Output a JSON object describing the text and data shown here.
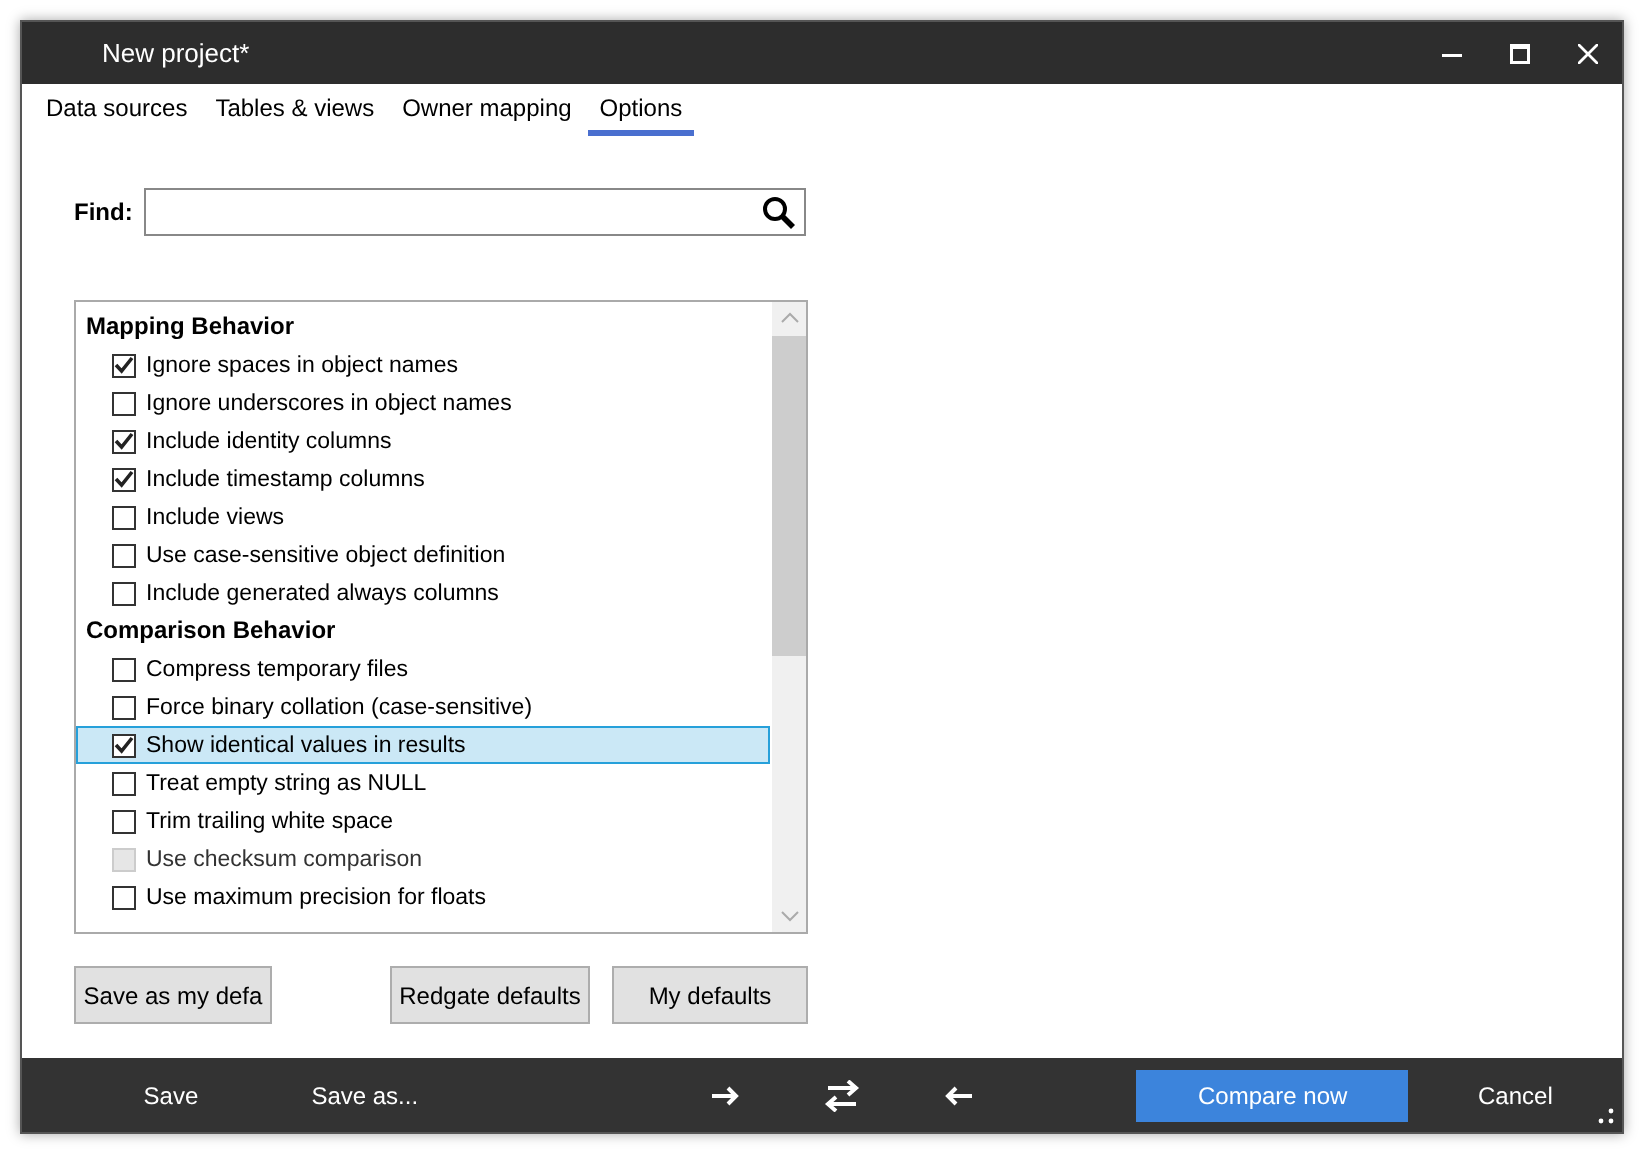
{
  "window": {
    "title": "New project*"
  },
  "tabs": [
    {
      "label": "Data sources",
      "selected": false
    },
    {
      "label": "Tables & views",
      "selected": false
    },
    {
      "label": "Owner mapping",
      "selected": false
    },
    {
      "label": "Options",
      "selected": true
    }
  ],
  "find": {
    "label": "Find:"
  },
  "option_groups": [
    {
      "title": "Mapping Behavior",
      "items": [
        {
          "label": "Ignore spaces in object names",
          "checked": true,
          "disabled": false,
          "selected": false
        },
        {
          "label": "Ignore underscores in object names",
          "checked": false,
          "disabled": false,
          "selected": false
        },
        {
          "label": "Include identity columns",
          "checked": true,
          "disabled": false,
          "selected": false
        },
        {
          "label": "Include timestamp columns",
          "checked": true,
          "disabled": false,
          "selected": false
        },
        {
          "label": "Include views",
          "checked": false,
          "disabled": false,
          "selected": false
        },
        {
          "label": "Use case-sensitive object definition",
          "checked": false,
          "disabled": false,
          "selected": false
        },
        {
          "label": "Include generated always columns",
          "checked": false,
          "disabled": false,
          "selected": false
        }
      ]
    },
    {
      "title": "Comparison Behavior",
      "items": [
        {
          "label": "Compress temporary files",
          "checked": false,
          "disabled": false,
          "selected": false
        },
        {
          "label": "Force binary collation (case-sensitive)",
          "checked": false,
          "disabled": false,
          "selected": false
        },
        {
          "label": "Show identical values in results",
          "checked": true,
          "disabled": false,
          "selected": true
        },
        {
          "label": "Treat empty string as NULL",
          "checked": false,
          "disabled": false,
          "selected": false
        },
        {
          "label": "Trim trailing white space",
          "checked": false,
          "disabled": false,
          "selected": false
        },
        {
          "label": "Use checksum comparison",
          "checked": false,
          "disabled": true,
          "selected": false
        },
        {
          "label": "Use maximum precision for floats",
          "checked": false,
          "disabled": false,
          "selected": false
        }
      ]
    }
  ],
  "option_buttons": [
    "Save as my defa",
    "Redgate defaults",
    "My defaults"
  ],
  "footer": {
    "save": "Save",
    "save_as": "Save as...",
    "compare": "Compare now",
    "cancel": "Cancel"
  }
}
